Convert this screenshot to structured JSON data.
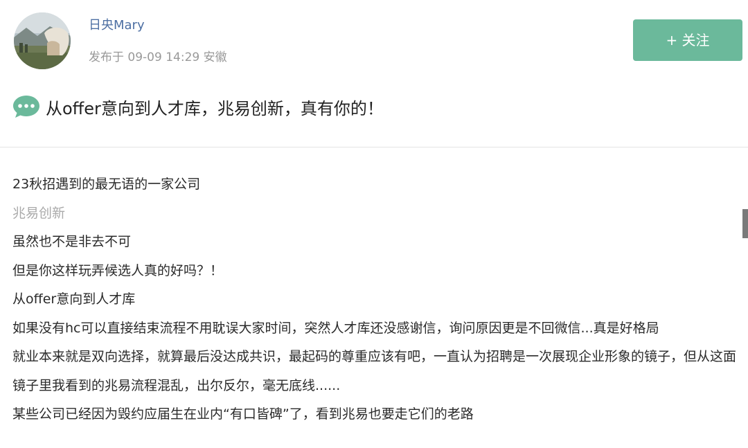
{
  "author": {
    "name": "日央Mary",
    "meta": "发布于 09-09 14:29 安徽"
  },
  "follow_button": {
    "label": "+ 关注"
  },
  "post": {
    "title": "从offer意向到人才库，兆易创新，真有你的！",
    "lines": [
      "23秋招遇到的最无语的一家公司",
      "兆易创新",
      "虽然也不是非去不可",
      "但是你这样玩弄候选人真的好吗？！",
      "从offer意向到人才库",
      "如果没有hc可以直接结束流程不用耽误大家时间，突然人才库还没感谢信，询问原因更是不回微信...真是好格局",
      "就业本来就是双向选择，就算最后没达成共识，最起码的尊重应该有吧，一直认为招聘是一次展现企业形象的镜子，但从这面镜子里我看到的兆易流程混乱，出尔反尔，毫无底线......",
      "某些公司已经因为毁约应届生在业内“有口皆碑”了，看到兆易也要走它们的老路"
    ]
  },
  "colors": {
    "accent": "#6bb99b",
    "author_name": "#4d6fa3",
    "meta": "#999999"
  },
  "icons": [
    "avatar",
    "chat-bubble-icon"
  ]
}
